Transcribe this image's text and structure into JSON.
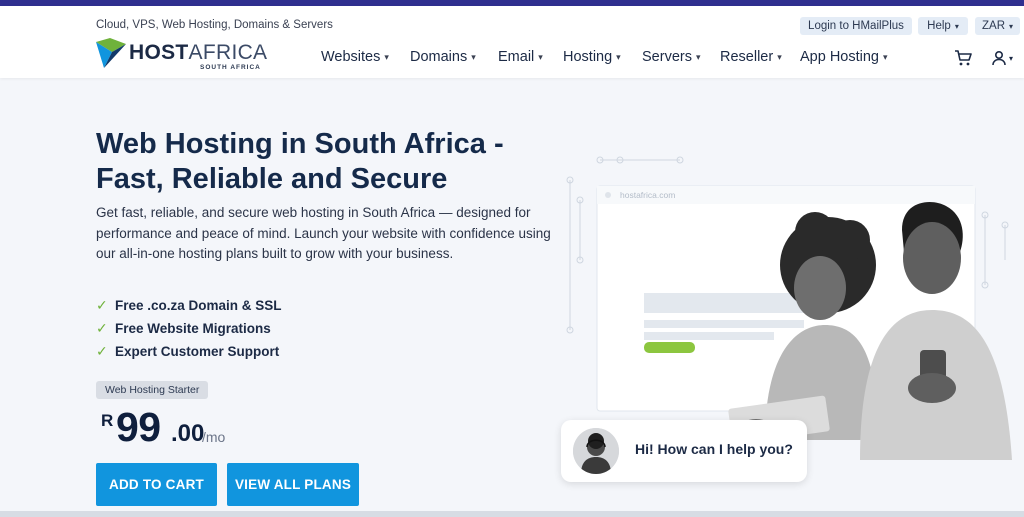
{
  "header": {
    "tagline": "Cloud, VPS, Web Hosting, Domains & Servers",
    "util": {
      "login": "Login to HMailPlus",
      "help": "Help",
      "currency": "ZAR"
    },
    "logo": {
      "brand_bold": "HOST",
      "brand_light": "AFRICA",
      "sub": "SOUTH AFRICA"
    },
    "nav": [
      "Websites",
      "Domains",
      "Email",
      "Hosting",
      "Servers",
      "Reseller",
      "App Hosting"
    ]
  },
  "hero": {
    "title": "Web Hosting in South Africa - Fast, Reliable and Secure",
    "description": "Get fast, reliable, and secure web hosting in South Africa — designed for performance and peace of mind. Launch your website with confidence using our all-in-one hosting plans built to grow with your business.",
    "features": [
      "Free .co.za Domain & SSL",
      "Free Website Migrations",
      "Expert Customer Support"
    ],
    "plan_label": "Web Hosting Starter",
    "price": {
      "currency": "R",
      "amount": "99",
      "cents": ".00",
      "period": "/mo"
    },
    "add_to_cart": "ADD TO CART",
    "view_all_plans": "VIEW ALL PLANS"
  },
  "illustration": {
    "url_bar": "hostafrica.com"
  },
  "chat": {
    "message": "Hi! How can I help you?"
  },
  "colors": {
    "accent": "#1195de",
    "check": "#6fb23b",
    "top_bar": "#2f2f8f",
    "heading": "#152a4a"
  }
}
